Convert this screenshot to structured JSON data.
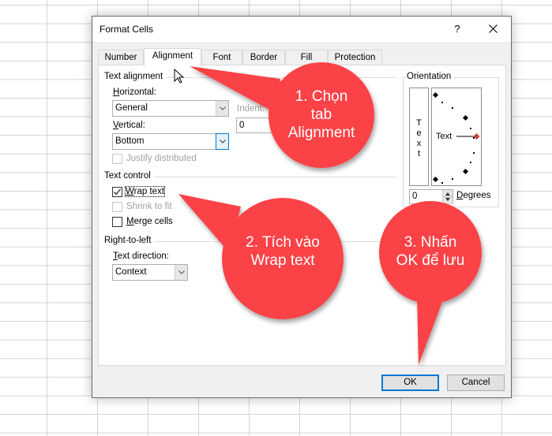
{
  "dialog": {
    "title": "Format Cells",
    "help_label": "?",
    "close_icon": "close-icon"
  },
  "tabs": [
    {
      "label": "Number",
      "active": false
    },
    {
      "label": "Alignment",
      "active": true
    },
    {
      "label": "Font",
      "active": false
    },
    {
      "label": "Border",
      "active": false
    },
    {
      "label": "Fill",
      "active": false
    },
    {
      "label": "Protection",
      "active": false
    }
  ],
  "text_alignment": {
    "group_label": "Text alignment",
    "horizontal_label_accel": "H",
    "horizontal_label_rest": "orizontal:",
    "horizontal_value": "General",
    "indent_label": "Indent:",
    "indent_value": "0",
    "vertical_label_accel": "V",
    "vertical_label_rest": "ertical:",
    "vertical_value": "Bottom",
    "justify_distributed_label": "Justify distributed",
    "justify_distributed_checked": false
  },
  "text_control": {
    "group_label": "Text control",
    "wrap_text_accel": "W",
    "wrap_text_rest": "rap text",
    "wrap_text_checked": true,
    "shrink_to_fit_label": "Shrink to fit",
    "shrink_to_fit_checked": false,
    "merge_cells_accel": "M",
    "merge_cells_rest": "erge cells",
    "merge_cells_checked": false
  },
  "right_to_left": {
    "group_label": "Right-to-left",
    "text_direction_accel": "T",
    "text_direction_rest": "ext direction:",
    "text_direction_value": "Context"
  },
  "orientation": {
    "group_label": "Orientation",
    "vertical_text_chars": [
      "T",
      "e",
      "x",
      "t"
    ],
    "dial_text": "Text",
    "degrees_value": "0",
    "degrees_accel": "D",
    "degrees_rest": "egrees",
    "angle_degrees": 0
  },
  "buttons": {
    "ok_label": "OK",
    "cancel_label": "Cancel"
  },
  "callouts": [
    {
      "line1": "1. Chọn",
      "line2": "tab",
      "line3": "Alignment"
    },
    {
      "line1": "2. Tích vào",
      "line2": "Wrap text"
    },
    {
      "line1": "3. Nhấn",
      "line2": "OK để lưu"
    }
  ],
  "colors": {
    "callout_red": "#fb4346",
    "focus_blue": "#0078d7",
    "orientation_marker": "#e0403c"
  }
}
